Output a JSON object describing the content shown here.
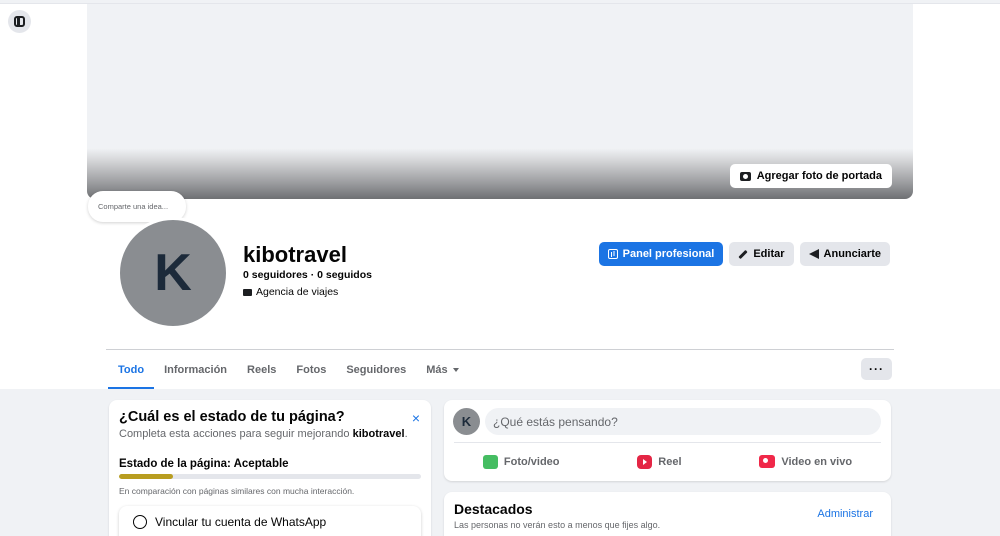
{
  "cover": {
    "add_cover_label": "Agregar foto de portada"
  },
  "bubble": {
    "placeholder": "Comparte una idea..."
  },
  "profile": {
    "avatar_letter": "K",
    "name": "kibotravel",
    "followers": "0 seguidores · 0 seguidos",
    "category": "Agencia de viajes"
  },
  "actions": {
    "professional_panel": "Panel profesional",
    "edit": "Editar",
    "advertise": "Anunciarte"
  },
  "tabs": [
    {
      "label": "Todo",
      "active": true
    },
    {
      "label": "Información"
    },
    {
      "label": "Reels"
    },
    {
      "label": "Fotos"
    },
    {
      "label": "Seguidores"
    },
    {
      "label": "Más"
    }
  ],
  "more_button": "···",
  "status_card": {
    "title": "¿Cuál es el estado de tu página?",
    "subtitle_prefix": "Completa esta acciones para seguir mejorando",
    "subtitle_page": "kibotravel",
    "subtitle_suffix": ".",
    "close_icon": "×",
    "status_label": "Estado de la página: Aceptable",
    "progress": 0.18,
    "progress_color": "#b89d20",
    "note": "En comparación con páginas similares con mucha interacción.",
    "whatsapp_label": "Vincular tu cuenta de WhatsApp"
  },
  "composer": {
    "avatar_letter": "K",
    "placeholder": "¿Qué estás pensando?",
    "photo_label": "Foto/video",
    "reel_label": "Reel",
    "live_label": "Video en vivo"
  },
  "featured": {
    "title": "Destacados",
    "subtitle": "Las personas no verán esto a menos que fijes algo.",
    "manage_label": "Administrar"
  },
  "colors": {
    "accent": "#1b74e4",
    "background": "#f0f2f5"
  }
}
